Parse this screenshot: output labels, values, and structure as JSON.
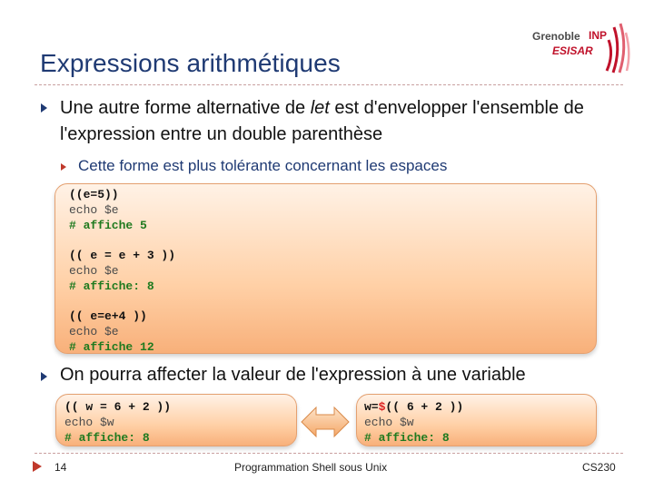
{
  "logo": {
    "brand": "Grenoble",
    "inp": "INP",
    "school": "ESISAR"
  },
  "slide": {
    "title": "Expressions arithmétiques",
    "bullet1": {
      "before": "Une autre forme alternative de ",
      "emph": "let",
      "after": " est d'envelopper l'ensemble de l'expression entre un double parenthèse"
    },
    "bullet1_sub": "Cette forme est plus tolérante concernant les espaces",
    "code_main": {
      "line1": "((e=5))",
      "line2": "echo $e",
      "line3": "# affiche 5",
      "line4": "(( e = e + 3 ))",
      "line5": "echo $e",
      "line6": "# affiche: 8",
      "line7": "(( e=e+4 ))",
      "line8": "echo $e",
      "line9": "# affiche 12"
    },
    "bullet2": "On pourra affecter la valeur de l'expression à une variable",
    "code_left": {
      "line1": "(( w = 6 + 2 ))",
      "line2": "echo $w",
      "line3": "# affiche: 8"
    },
    "code_right": {
      "prefix": "w=",
      "dollar": "$",
      "rest": "(( 6 + 2 ))",
      "line2": "echo $w",
      "line3": "# affiche: 8"
    }
  },
  "footer": {
    "page": "14",
    "center": "Programmation Shell sous Unix",
    "right": "CS230"
  },
  "colors": {
    "title": "#1f3a73",
    "accent_red": "#c0392b",
    "code_green": "#1f7a1f",
    "box_orange": "#f8b07a"
  }
}
